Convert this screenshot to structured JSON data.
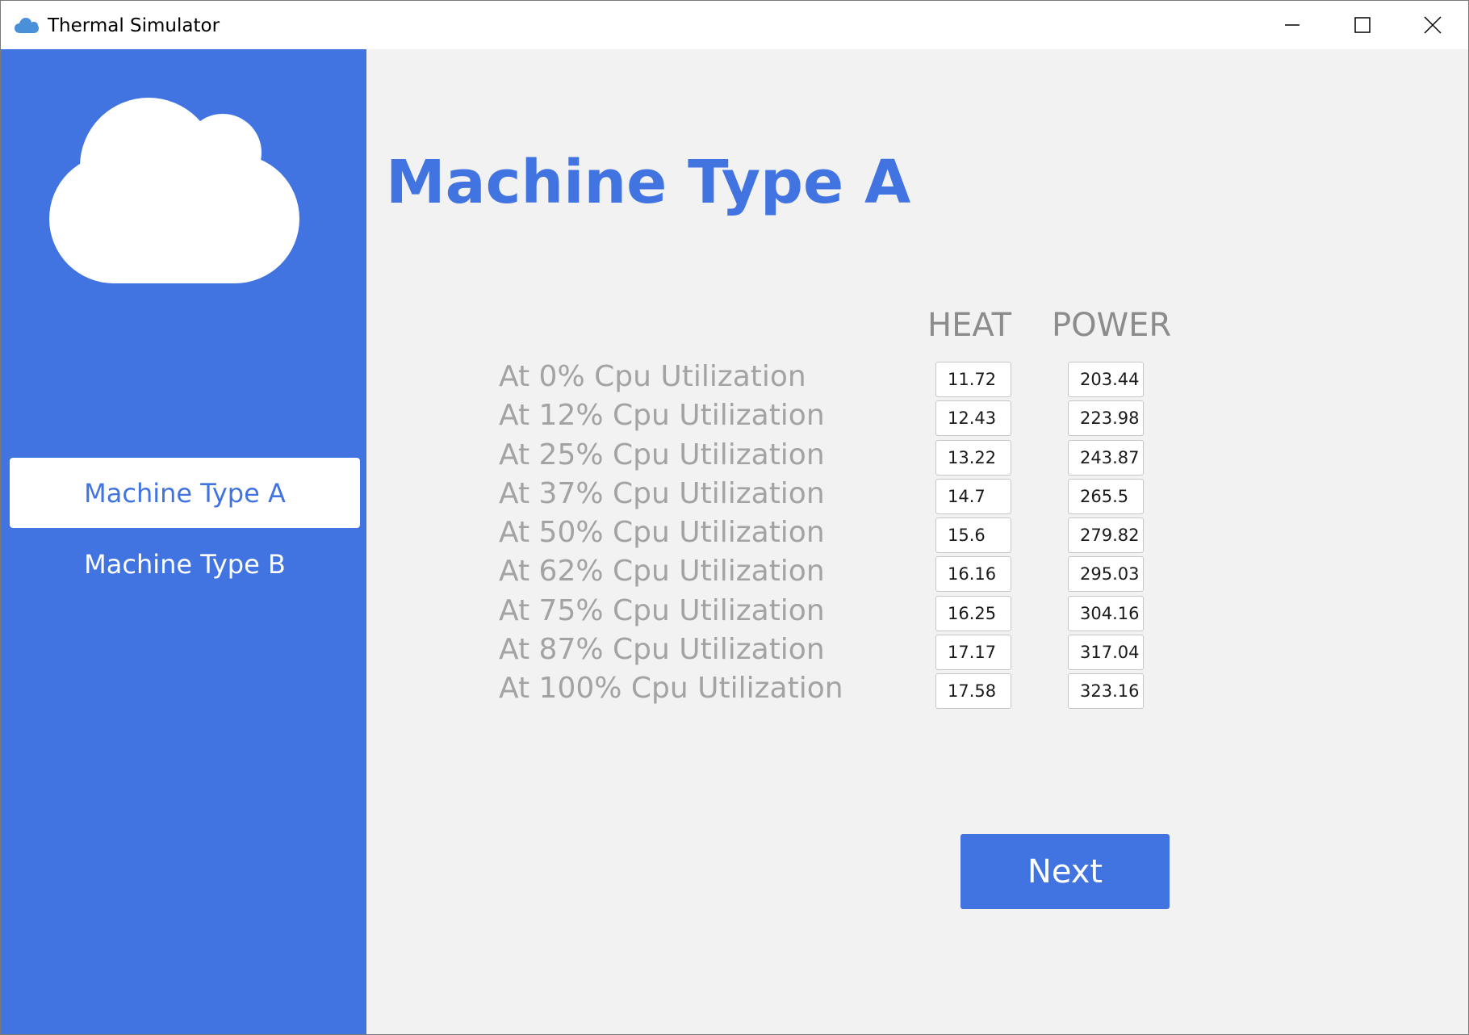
{
  "window": {
    "title": "Thermal Simulator",
    "app_icon": "cloud-icon",
    "controls": [
      "minimize-icon",
      "maximize-icon",
      "close-icon"
    ]
  },
  "sidebar": {
    "logo_icon": "cloud-icon",
    "items": [
      {
        "label": "Machine Type A",
        "selected": true
      },
      {
        "label": "Machine Type B",
        "selected": false
      }
    ]
  },
  "main": {
    "title": "Machine Type A",
    "columns": {
      "heat": "HEAT",
      "power": "POWER"
    },
    "rows": [
      {
        "label": "At 0% Cpu Utilization",
        "heat": "11.72",
        "power": "203.44"
      },
      {
        "label": "At 12% Cpu Utilization",
        "heat": "12.43",
        "power": "223.98"
      },
      {
        "label": "At 25% Cpu Utilization",
        "heat": "13.22",
        "power": "243.87"
      },
      {
        "label": "At 37% Cpu Utilization",
        "heat": "14.7",
        "power": "265.5"
      },
      {
        "label": "At 50% Cpu Utilization",
        "heat": "15.6",
        "power": "279.82"
      },
      {
        "label": "At 62% Cpu Utilization",
        "heat": "16.16",
        "power": "295.03"
      },
      {
        "label": "At 75% Cpu Utilization",
        "heat": "16.25",
        "power": "304.16"
      },
      {
        "label": "At 87% Cpu Utilization",
        "heat": "17.17",
        "power": "317.04"
      },
      {
        "label": "At 100% Cpu Utilization",
        "heat": "17.58",
        "power": "323.16"
      }
    ],
    "next_label": "Next"
  },
  "colors": {
    "accent": "#4174e0",
    "label_gray": "#a3a3a3",
    "header_gray": "#8c8c8c",
    "background": "#f2f2f2"
  }
}
